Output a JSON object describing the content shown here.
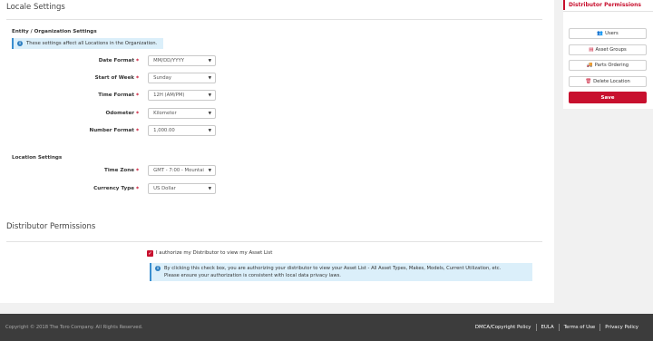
{
  "locale": {
    "title": "Locale Settings",
    "entity_title": "Entity / Organization Settings",
    "entity_info": "These settings affect all Locations in the Organization.",
    "entity_fields": [
      {
        "label": "Date Format",
        "value": "MM/DD/YYYY"
      },
      {
        "label": "Start of Week",
        "value": "Sunday"
      },
      {
        "label": "Time Format",
        "value": "12H (AM/PM)"
      },
      {
        "label": "Odometer",
        "value": "Kilometer"
      },
      {
        "label": "Number Format",
        "value": "1,000.00"
      }
    ],
    "location_title": "Location Settings",
    "location_fields": [
      {
        "label": "Time Zone",
        "value": "GMT - 7:00 - Mountai"
      },
      {
        "label": "Currency Type",
        "value": "US Dollar"
      }
    ],
    "required_mark": "*",
    "info_icon": "i"
  },
  "distributor": {
    "title": "Distributor Permissions",
    "checkbox_label": "I authorize my Distributor to view my Asset List",
    "checkbox_checked": true,
    "checkbox_glyph": "✓",
    "info_line1": "By clicking this check box, you are authorizing your distributor to view your Asset List - All Asset Types, Makes, Models, Current Utilization, etc.",
    "info_line2": "Please ensure your authorization is consistent with local data privacy laws."
  },
  "side": {
    "title": "Distributor Permissions",
    "buttons": [
      {
        "label": "Users",
        "icon": "users-icon",
        "glyph": "👥"
      },
      {
        "label": "Asset Groups",
        "icon": "list-icon",
        "glyph": "▤"
      },
      {
        "label": "Parts Ordering",
        "icon": "truck-icon",
        "glyph": "🚚"
      },
      {
        "label": "Delete Location",
        "icon": "trash-icon",
        "glyph": "🗑"
      }
    ],
    "save_label": "Save"
  },
  "footer": {
    "copyright": "Copyright © 2018 The Toro Company. All Rights Reserved.",
    "links": [
      "DMCA/Copyright Policy",
      "EULA",
      "Terms of Use",
      "Privacy Policy"
    ]
  },
  "colors": {
    "accent": "#c8102e",
    "info_bg": "#dbeffa",
    "footer_bg": "#3c3c3c"
  }
}
